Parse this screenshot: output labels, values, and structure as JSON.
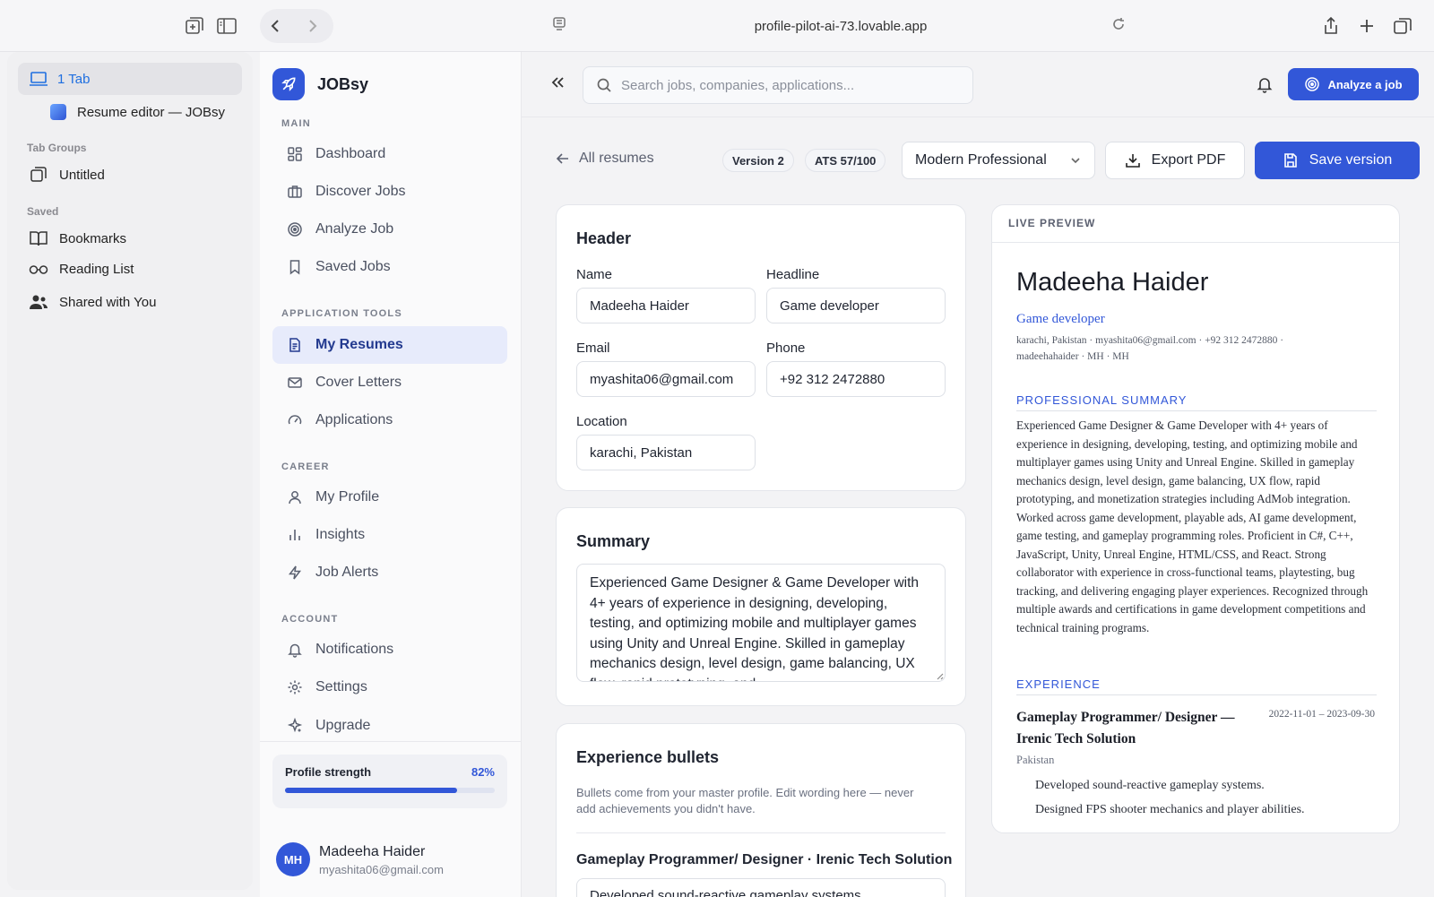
{
  "browser": {
    "url": "profile-pilot-ai-73.lovable.app",
    "sidebar": {
      "current_tab_group": "1 Tab",
      "open_tab": "Resume editor — JOBsy",
      "tab_groups_heading": "Tab Groups",
      "tab_groups": [
        "Untitled"
      ],
      "saved_heading": "Saved",
      "saved_items": [
        {
          "label": "Bookmarks",
          "icon": "book-icon"
        },
        {
          "label": "Reading List",
          "icon": "glasses-icon"
        },
        {
          "label": "Shared with You",
          "icon": "people-icon"
        }
      ]
    }
  },
  "app": {
    "brand": "JOBsy",
    "accent": "#3257d8",
    "sections": [
      {
        "heading": "MAIN",
        "items": [
          {
            "label": "Dashboard",
            "icon": "grid-icon"
          },
          {
            "label": "Discover Jobs",
            "icon": "briefcase-icon"
          },
          {
            "label": "Analyze Job",
            "icon": "target-icon"
          },
          {
            "label": "Saved Jobs",
            "icon": "bookmark-icon"
          }
        ]
      },
      {
        "heading": "APPLICATION TOOLS",
        "items": [
          {
            "label": "My Resumes",
            "icon": "document-icon",
            "active": true
          },
          {
            "label": "Cover Letters",
            "icon": "mail-icon"
          },
          {
            "label": "Applications",
            "icon": "gauge-icon"
          }
        ]
      },
      {
        "heading": "CAREER",
        "items": [
          {
            "label": "My Profile",
            "icon": "user-icon"
          },
          {
            "label": "Insights",
            "icon": "bar-chart-icon"
          },
          {
            "label": "Job Alerts",
            "icon": "lightning-icon"
          }
        ]
      },
      {
        "heading": "ACCOUNT",
        "items": [
          {
            "label": "Notifications",
            "icon": "bell-icon"
          },
          {
            "label": "Settings",
            "icon": "gear-icon"
          },
          {
            "label": "Upgrade",
            "icon": "sparkle-icon"
          }
        ]
      }
    ],
    "profile_strength": {
      "label": "Profile strength",
      "value_text": "82%",
      "value": 0.82
    },
    "user": {
      "initials": "MH",
      "name": "Madeeha Haider",
      "email": "myashita06@gmail.com"
    }
  },
  "header": {
    "search_placeholder": "Search jobs, companies, applications...",
    "analyze_button": "Analyze a job"
  },
  "toolbar": {
    "back_link": "All resumes",
    "version_badge": "Version 2",
    "ats_badge": "ATS 57/100",
    "template": "Modern Professional",
    "export_button": "Export PDF",
    "save_button": "Save version"
  },
  "editor": {
    "header_card": {
      "title": "Header",
      "name_label": "Name",
      "name_value": "Madeeha Haider",
      "headline_label": "Headline",
      "headline_value": "Game developer",
      "email_label": "Email",
      "email_value": "myashita06@gmail.com",
      "phone_label": "Phone",
      "phone_value": "+92 312 2472880",
      "location_label": "Location",
      "location_value": "karachi, Pakistan"
    },
    "summary_card": {
      "title": "Summary",
      "text": "Experienced Game Designer & Game Developer with 4+ years of experience in designing, developing, testing, and optimizing mobile and multiplayer games using Unity and Unreal Engine. Skilled in gameplay mechanics design, level design, game balancing, UX flow, rapid prototyping, and"
    },
    "bullets_card": {
      "title": "Experience bullets",
      "hint": "Bullets come from your master profile. Edit wording here — never add achievements you didn't have.",
      "role": "Gameplay Programmer/ Designer · Irenic Tech Solution",
      "first_bullet": "Developed sound-reactive gameplay systems."
    }
  },
  "preview": {
    "label": "LIVE PREVIEW",
    "name": "Madeeha Haider",
    "headline": "Game developer",
    "contact": "karachi, Pakistan · myashita06@gmail.com · +92 312 2472880 · madeehahaider · MH · MH",
    "summary_heading": "PROFESSIONAL SUMMARY",
    "summary": "Experienced Game Designer & Game Developer with 4+ years of experience in designing, developing, testing, and optimizing mobile and multiplayer games using Unity and Unreal Engine. Skilled in gameplay mechanics design, level design, game balancing, UX flow, rapid prototyping, and monetization strategies including AdMob integration. Worked across game development, playable ads, AI game development, game testing, and gameplay programming roles. Proficient in C#, C++, JavaScript, Unity, Unreal Engine, HTML/CSS, and React. Strong collaborator with experience in cross-functional teams, playtesting, bug tracking, and delivering engaging player experiences. Recognized through multiple awards and certifications in game development competitions and technical training programs.",
    "experience_heading": "EXPERIENCE",
    "job": {
      "title": "Gameplay Programmer/ Designer — Irenic Tech Solution",
      "dates": "2022-11-01 – 2023-09-30",
      "location": "Pakistan",
      "bullets": [
        "Developed sound-reactive gameplay systems.",
        "Designed FPS shooter mechanics and player abilities."
      ]
    }
  }
}
